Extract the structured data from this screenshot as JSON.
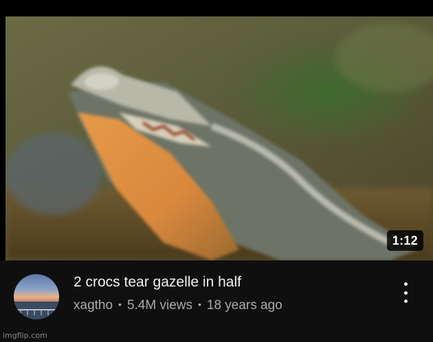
{
  "video": {
    "duration": "1:12",
    "title": "2 crocs tear gazelle in half",
    "channel": "xagtho",
    "views": "5.4M views",
    "age": "18 years ago",
    "separator": "•"
  },
  "watermark": "imgflip.com",
  "icons": {
    "more": "more-vertical-icon",
    "avatar": "channel-avatar"
  }
}
